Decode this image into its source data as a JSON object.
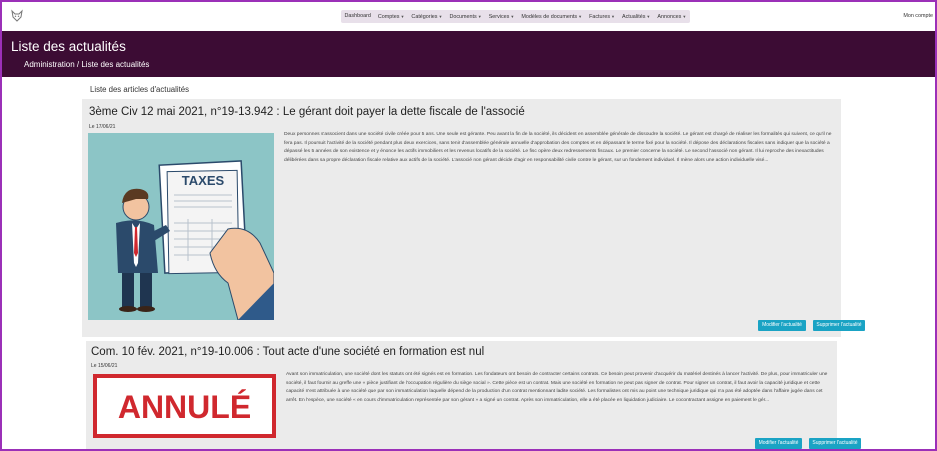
{
  "nav": {
    "menu": [
      "Dashboard",
      "Comptes",
      "Catégories",
      "Documents",
      "Services",
      "Modèles de documents",
      "Factures",
      "Actualités",
      "Annonces"
    ],
    "menu_dropdown": [
      false,
      true,
      true,
      true,
      true,
      true,
      true,
      true,
      true
    ],
    "account": "Mon compte"
  },
  "header": {
    "title": "Liste des actualités",
    "breadcrumb": "Administration / Liste des actualités"
  },
  "section_title": "Liste des articles d'actualités",
  "articles": [
    {
      "title": "3ème Civ 12 mai 2021, n°19-13.942 : Le gérant doit payer la dette fiscale de l'associé",
      "date": "Le 17/06/21",
      "image_text": "TAXES",
      "excerpt": "Deux personnes s'associent dans une société civile créée pour 5 ans. Une seule est gérante. Peu avant la fin de la société, ils décident en assemblée générale de dissoudre la société. Le gérant est chargé de réaliser les formalités qui suivent, ce qu'il ne fera pas. Il poursuit l'activité de la société pendant plus deux exercices, sans tenir d'assemblée générale annuelle d'approbation des comptes et en dépassant le terme fixé pour la société. Il dépose des déclarations fiscales sans indiquer que la société a dépassé les 5 années de son existence et y énonce les actifs immobiliers et les revenus locatifs de la société.   Le fisc opère deux redressements fiscaux. Le premier concerne la société. Le second l'associé non gérant. Il lui reproche des inexactitudes délibérées dans sa propre déclaration fiscale relative aux actifs de la société. L'associé non gérant décide d'agir en responsabilité civile contre le gérant, sur un fondement individuel. Il mène alors une action individuelle visé...",
      "edit_label": "Modifier l'actualité",
      "delete_label": "Supprimer l'actualité"
    },
    {
      "title": "Com. 10 fév. 2021, n°19-10.006 : Tout acte d'une société en formation est nul",
      "date": "Le 15/06/21",
      "image_text": "ANNULÉ",
      "excerpt": "Avant son immatriculation, une société dont les statuts ont été signés est en formation. Les fondateurs ont besoin de contracter certains contrats. Ce besoin peut provenir d'acquérir du matériel destinés à lancer l'activité. De plus, pour immatriculer une société, il faut fournir au greffe une « pièce justifiant de l'occupation régulière du siège social ». Cette pièce est un contrat. Mais une société en formation ne peut pas signer de contrat. Pour signer un contrat, il faut avoir la capacité juridique et cette capacité n'est attribuée à une société que par son immatriculation laquelle dépend de la production d'un contrat mentionnant ladite société. Les formalistes ont mis au point une technique juridique qui n'a pas été adoptée dans l'affaire jugée dans cet arrêt. En l'espèce, une société « en cours d'immatriculation représentée par son gérant » a signé un contrat. Après son immatriculation, elle a été placée en liquidation judiciaire. Le cocontractant assigne en paiement le gér...",
      "edit_label": "Modifier l'actualité",
      "delete_label": "Supprimer l'actualité"
    }
  ],
  "colors": {
    "header_bg": "#3c0c34",
    "frame_border": "#9b30b8",
    "button_bg": "#1aa3c4",
    "card_bg": "#ebebeb",
    "annule_red": "#d0282e"
  },
  "icons": {
    "logo": "fox-logo-icon",
    "menu_caret": "caret-down-icon"
  }
}
